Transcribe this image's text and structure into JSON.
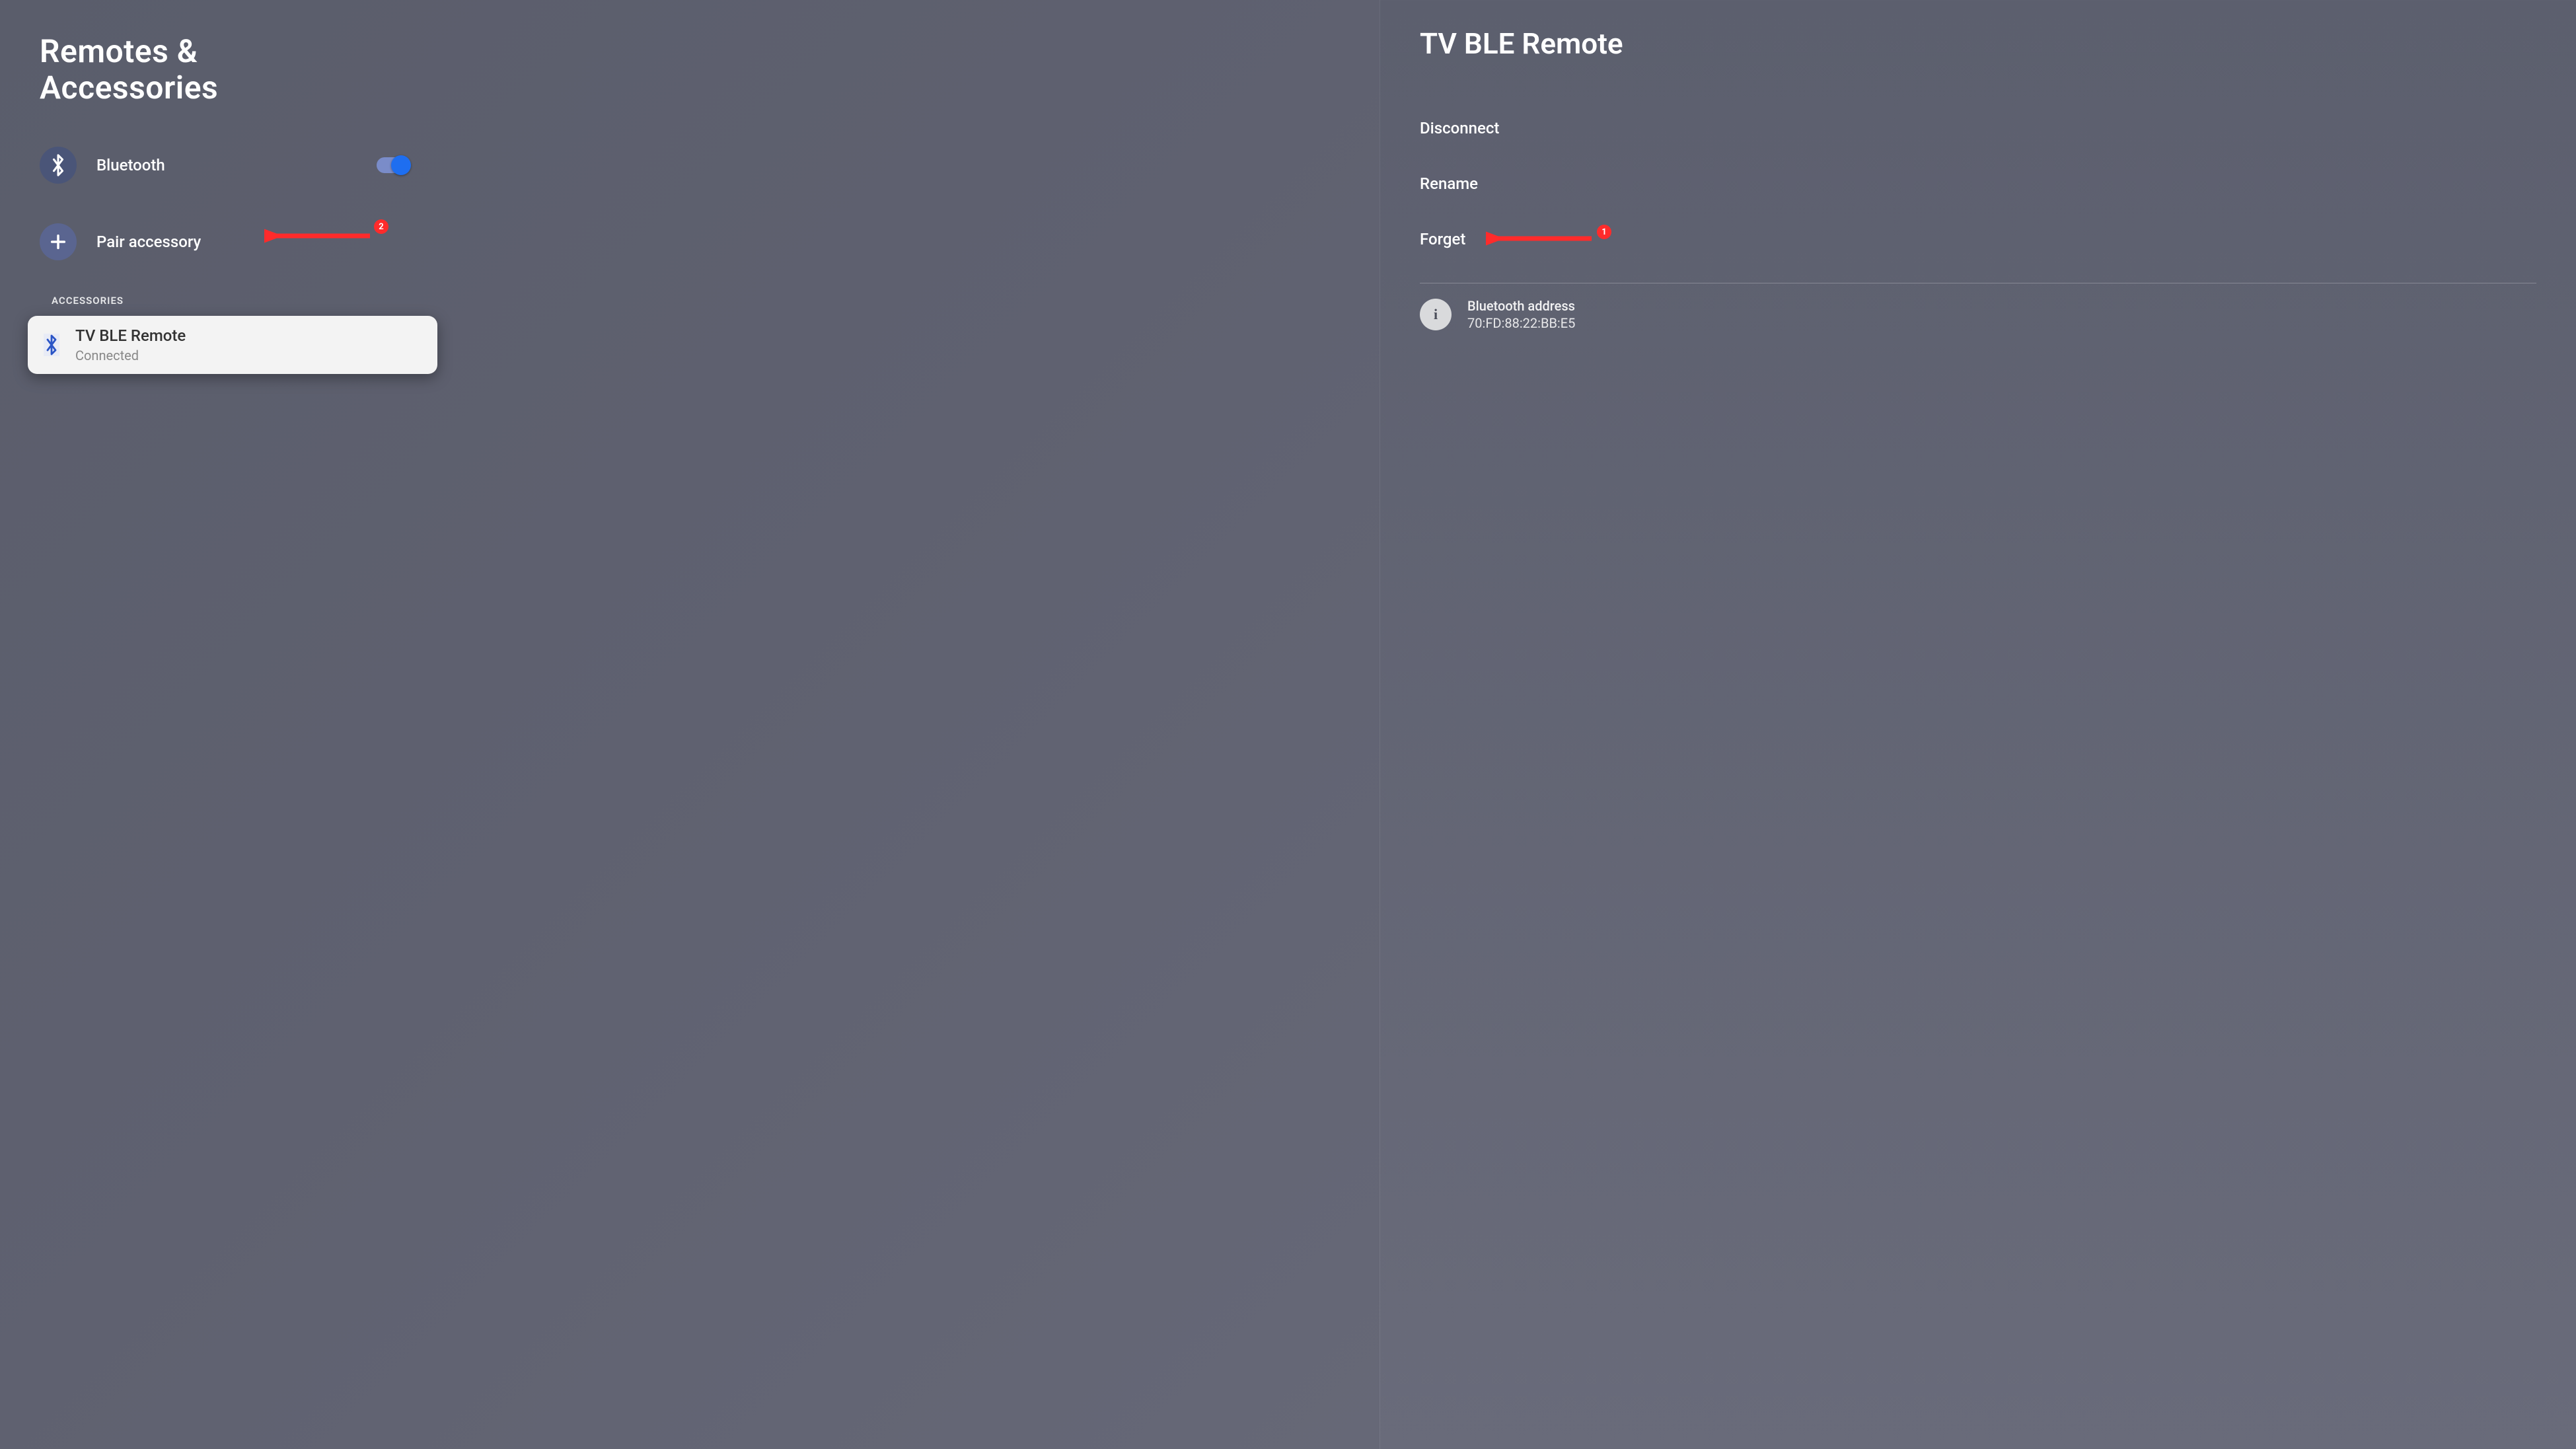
{
  "left": {
    "title": "Remotes & Accessories",
    "bluetooth_label": "Bluetooth",
    "bluetooth_on": true,
    "pair_label": "Pair accessory",
    "section_header": "ACCESSORIES",
    "device": {
      "name": "TV BLE Remote",
      "status": "Connected"
    }
  },
  "right": {
    "title": "TV BLE Remote",
    "actions": {
      "disconnect": "Disconnect",
      "rename": "Rename",
      "forget": "Forget"
    },
    "info": {
      "label": "Bluetooth address",
      "value": "70:FD:88:22:BB:E5"
    }
  },
  "annotations": {
    "badge1": "1",
    "badge2": "2"
  },
  "colors": {
    "accent_toggle": "#1e6ef0",
    "annotation": "#ff2b2b"
  }
}
